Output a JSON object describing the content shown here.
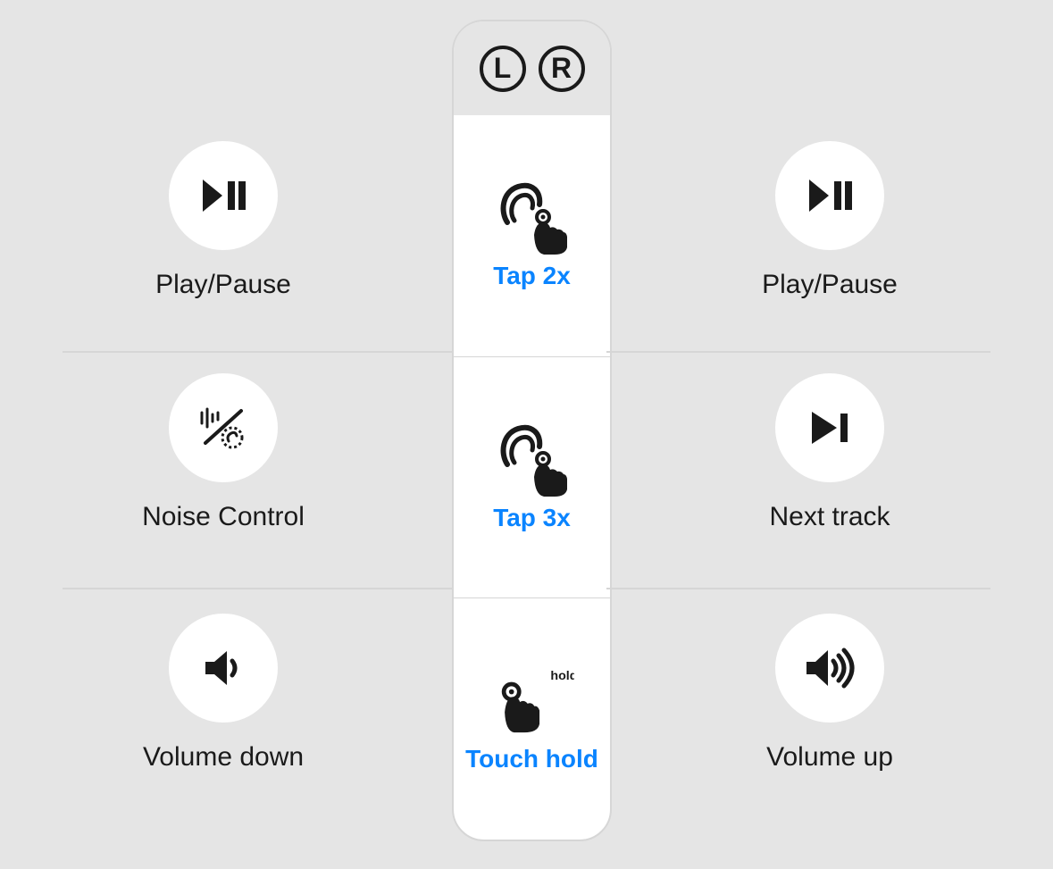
{
  "header": {
    "left": "L",
    "right": "R"
  },
  "gestures": {
    "tap2": {
      "label": "Tap 2x"
    },
    "tap3": {
      "label": "Tap 3x"
    },
    "hold": {
      "label": "Touch hold",
      "hold_text": "hold"
    }
  },
  "rows": [
    {
      "left": {
        "label": "Play/Pause",
        "icon": "play-pause-icon"
      },
      "right": {
        "label": "Play/Pause",
        "icon": "play-pause-icon"
      }
    },
    {
      "left": {
        "label": "Noise Control",
        "icon": "noise-control-icon"
      },
      "right": {
        "label": "Next track",
        "icon": "next-track-icon"
      }
    },
    {
      "left": {
        "label": "Volume down",
        "icon": "volume-down-icon"
      },
      "right": {
        "label": "Volume up",
        "icon": "volume-up-icon"
      }
    }
  ],
  "colors": {
    "accent": "#0a84ff"
  }
}
